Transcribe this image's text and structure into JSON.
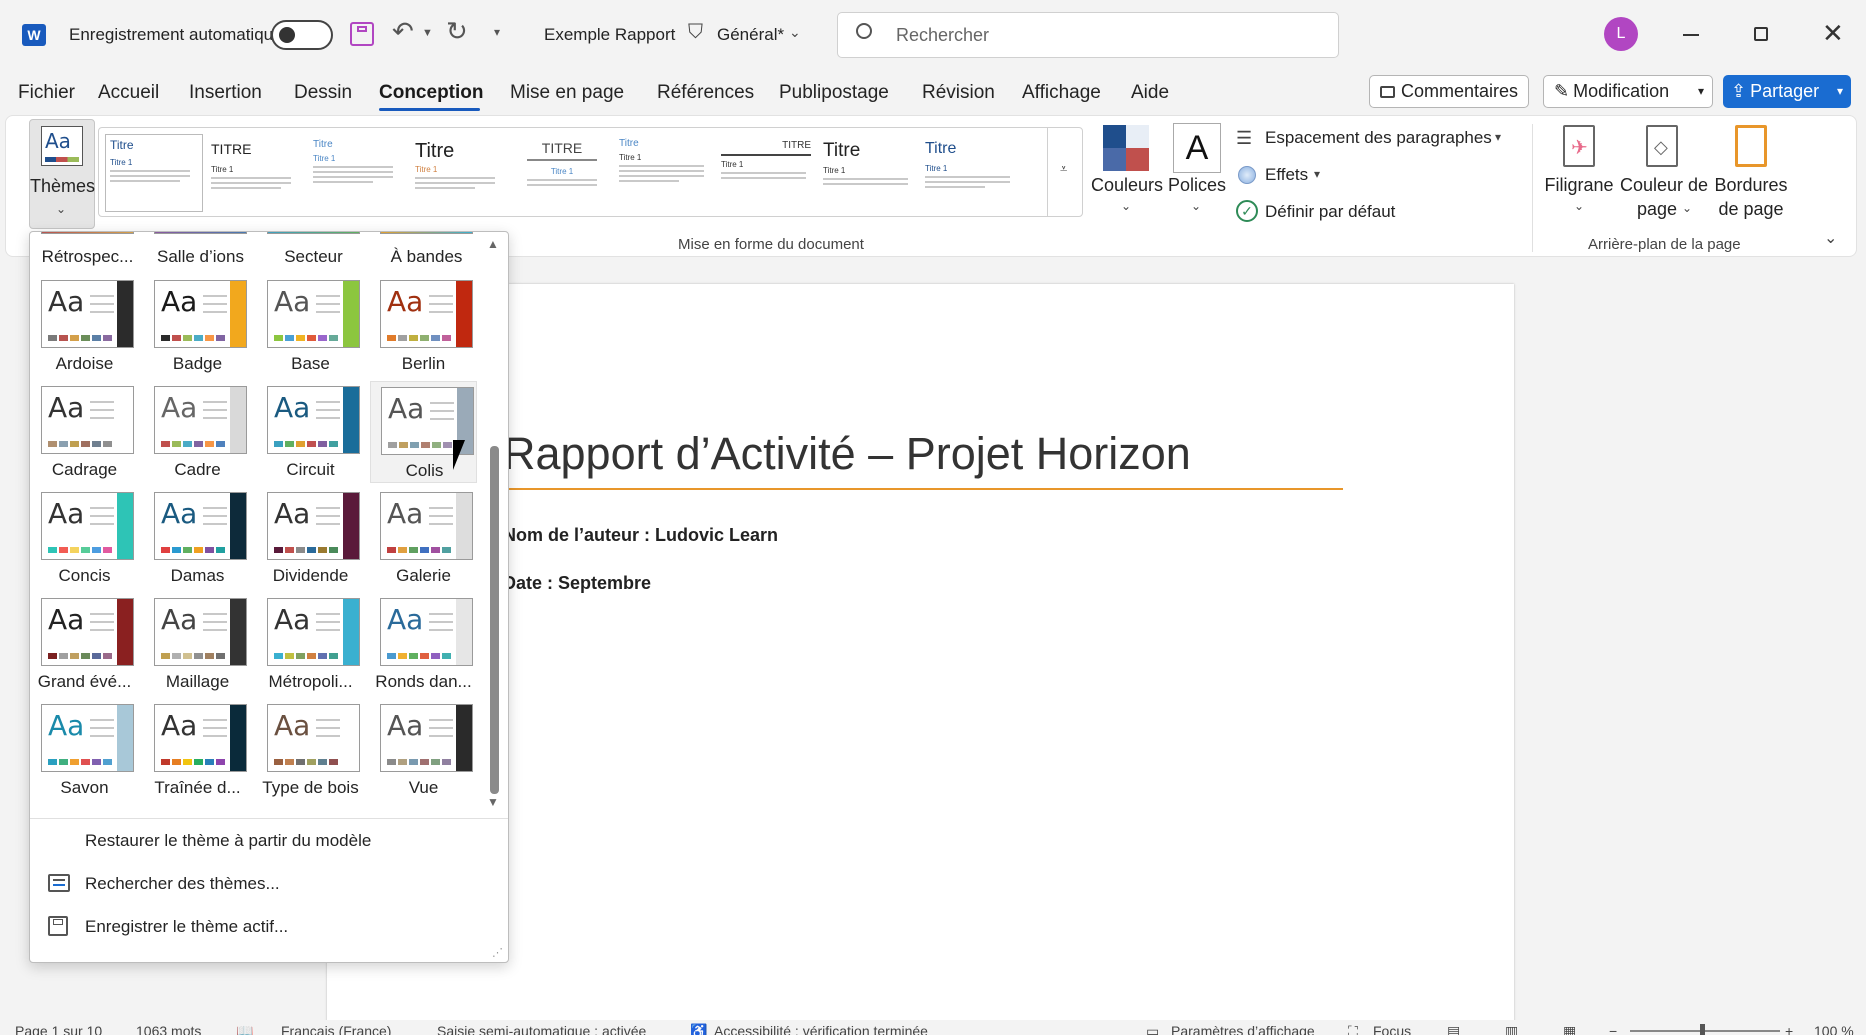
{
  "titlebar": {
    "autosave_label": "Enregistrement automatique",
    "doc_title": "Exemple Rapport",
    "sensitivity": "Général*",
    "search_placeholder": "Rechercher",
    "avatar_initial": "L"
  },
  "menu": {
    "tabs": [
      "Fichier",
      "Accueil",
      "Insertion",
      "Dessin",
      "Conception",
      "Mise en page",
      "Références",
      "Publipostage",
      "Révision",
      "Affichage",
      "Aide"
    ],
    "active": "Conception",
    "comments_label": "Commentaires",
    "mode_label": "Modification",
    "share_label": "Partager"
  },
  "ribbon": {
    "themes_label": "Thèmes",
    "style_samples": [
      "Titre",
      "TITRE",
      "Titre",
      "Titre",
      "TITRE",
      "Titre",
      "TITRE",
      "Titre",
      "Titre"
    ],
    "subtitle_sample": "Titre 1",
    "group_document_format": "Mise en forme du document",
    "colors_label": "Couleurs",
    "fonts_label": "Polices",
    "paragraph_spacing_label": "Espacement des paragraphes",
    "effects_label": "Effets",
    "set_default_label": "Définir par défaut",
    "watermark_label": "Filigrane",
    "page_color_label1": "Couleur de",
    "page_color_label2": "page",
    "page_borders_label1": "Bordures",
    "page_borders_label2": "de page",
    "group_page_background": "Arrière-plan de la page"
  },
  "themes_dropdown": {
    "top_row": [
      "Rétrospec...",
      "Salle d’ions",
      "Secteur",
      "À bandes"
    ],
    "themes": [
      {
        "name": "Ardoise",
        "band": "#2b2b2b",
        "dots": [
          "#7a7a7a",
          "#b85450",
          "#d4a04a",
          "#6b8e5a",
          "#5b7fa6",
          "#8a6aa0"
        ],
        "aa": "#333"
      },
      {
        "name": "Badge",
        "band": "#f2a81d",
        "dots": [
          "#2b2b2b",
          "#c0504d",
          "#9bbb59",
          "#4bacc6",
          "#f79646",
          "#8064a2"
        ],
        "aa": "#1a1a1a"
      },
      {
        "name": "Base",
        "band": "#8cc63f",
        "dots": [
          "#8cc63f",
          "#4aa0d5",
          "#f0b323",
          "#e05a3a",
          "#9966cc",
          "#66aa99"
        ],
        "aa": "#555"
      },
      {
        "name": "Berlin",
        "band": "#c0280f",
        "dots": [
          "#e07b2a",
          "#a0a0a0",
          "#c0b040",
          "#8fb070",
          "#7090c0",
          "#c0609a"
        ],
        "aa": "#a03010"
      },
      {
        "name": "Cadrage",
        "band": "#ffffff",
        "dots": [
          "#b09070",
          "#8aa0b0",
          "#c0a050",
          "#a07060",
          "#708090",
          "#909090"
        ],
        "aa": "#333"
      },
      {
        "name": "Cadre",
        "band": "#d9d9d9",
        "dots": [
          "#c0504d",
          "#9bbb59",
          "#4bacc6",
          "#8064a2",
          "#f79646",
          "#4f81bd"
        ],
        "aa": "#666"
      },
      {
        "name": "Circuit",
        "band": "#1a6d9a",
        "dots": [
          "#3aa0c0",
          "#60b060",
          "#e0a030",
          "#c05050",
          "#8060a0",
          "#40a0a0"
        ],
        "aa": "#1a5a80"
      },
      {
        "name": "Colis",
        "band": "#9aaab8",
        "dots": [
          "#a0a0a0",
          "#c0a060",
          "#80a0b0",
          "#b08070",
          "#90b080",
          "#a090b0"
        ],
        "aa": "#555"
      },
      {
        "name": "Concis",
        "band": "#2ec4b6",
        "dots": [
          "#2ec4b6",
          "#f25c54",
          "#f4d35e",
          "#57cc99",
          "#4d9de0",
          "#e15aa0"
        ],
        "aa": "#333"
      },
      {
        "name": "Damas",
        "band": "#0d2a3a",
        "dots": [
          "#e04040",
          "#2a9ad0",
          "#60b060",
          "#f0a020",
          "#8050a0",
          "#20a0a0"
        ],
        "aa": "#1a5a80"
      },
      {
        "name": "Dividende",
        "band": "#5a1a3a",
        "dots": [
          "#5a1a3a",
          "#c0504d",
          "#8a8a8a",
          "#2a6a9a",
          "#9a7a30",
          "#4a8a5a"
        ],
        "aa": "#333"
      },
      {
        "name": "Galerie",
        "band": "#dddddd",
        "dots": [
          "#c04040",
          "#e0a040",
          "#60a060",
          "#4070c0",
          "#a050a0",
          "#50a0a0"
        ],
        "aa": "#555"
      },
      {
        "name": "Grand évé...",
        "band": "#8a2020",
        "dots": [
          "#7a2020",
          "#a0a0a0",
          "#c0a060",
          "#6a8a5a",
          "#5a6a9a",
          "#9a6a8a"
        ],
        "aa": "#222"
      },
      {
        "name": "Maillage",
        "band": "#333333",
        "dots": [
          "#c0a050",
          "#b0b0b0",
          "#d0c090",
          "#909090",
          "#a08060",
          "#707070"
        ],
        "aa": "#444"
      },
      {
        "name": "Métropoli...",
        "band": "#3ab0d0",
        "dots": [
          "#3ab0d0",
          "#c0c040",
          "#80a060",
          "#d08040",
          "#6070b0",
          "#40a090"
        ],
        "aa": "#333"
      },
      {
        "name": "Ronds dan...",
        "band": "#e6e6e6",
        "dots": [
          "#4a9ad0",
          "#f0b030",
          "#60b060",
          "#e06040",
          "#9060c0",
          "#40b0b0"
        ],
        "aa": "#2a6a9a"
      },
      {
        "name": "Savon",
        "band": "#a8c8d8",
        "dots": [
          "#2aa0c0",
          "#40b080",
          "#f0a030",
          "#e05050",
          "#8060b0",
          "#50a0d0"
        ],
        "aa": "#1a8aaa"
      },
      {
        "name": "Traînée d...",
        "band": "#0a2a3a",
        "dots": [
          "#c0392b",
          "#e67e22",
          "#f1c40f",
          "#27ae60",
          "#2980b9",
          "#8e44ad"
        ],
        "aa": "#333"
      },
      {
        "name": "Type de bois",
        "band": "#ffffff",
        "dots": [
          "#9a6040",
          "#c08050",
          "#707070",
          "#a0a060",
          "#608090",
          "#905050"
        ],
        "aa": "#6a5040"
      },
      {
        "name": "Vue",
        "band": "#2a2a2a",
        "dots": [
          "#8a8a8a",
          "#b0a080",
          "#7a9ab0",
          "#a07070",
          "#80a080",
          "#9080a0"
        ],
        "aa": "#555"
      }
    ],
    "restore_label": "Restaurer le thème à partir du modèle",
    "search_label": "Rechercher des thèmes...",
    "save_label": "Enregistrer le thème actif..."
  },
  "document": {
    "title": "Rapport d’Activité – Projet Horizon",
    "author_line": "Nom de l’auteur : Ludovic Learn",
    "date_line": "Date : Septembre"
  },
  "statusbar": {
    "page": "Page 1 sur 10",
    "words": "1063 mots",
    "language": "Français (France)",
    "autocomplete": "Saisie semi-automatique : activée",
    "accessibility": "Accessibilité : vérification terminée",
    "display_settings": "Paramètres d’affichage",
    "focus": "Focus",
    "zoom": "100 %"
  }
}
